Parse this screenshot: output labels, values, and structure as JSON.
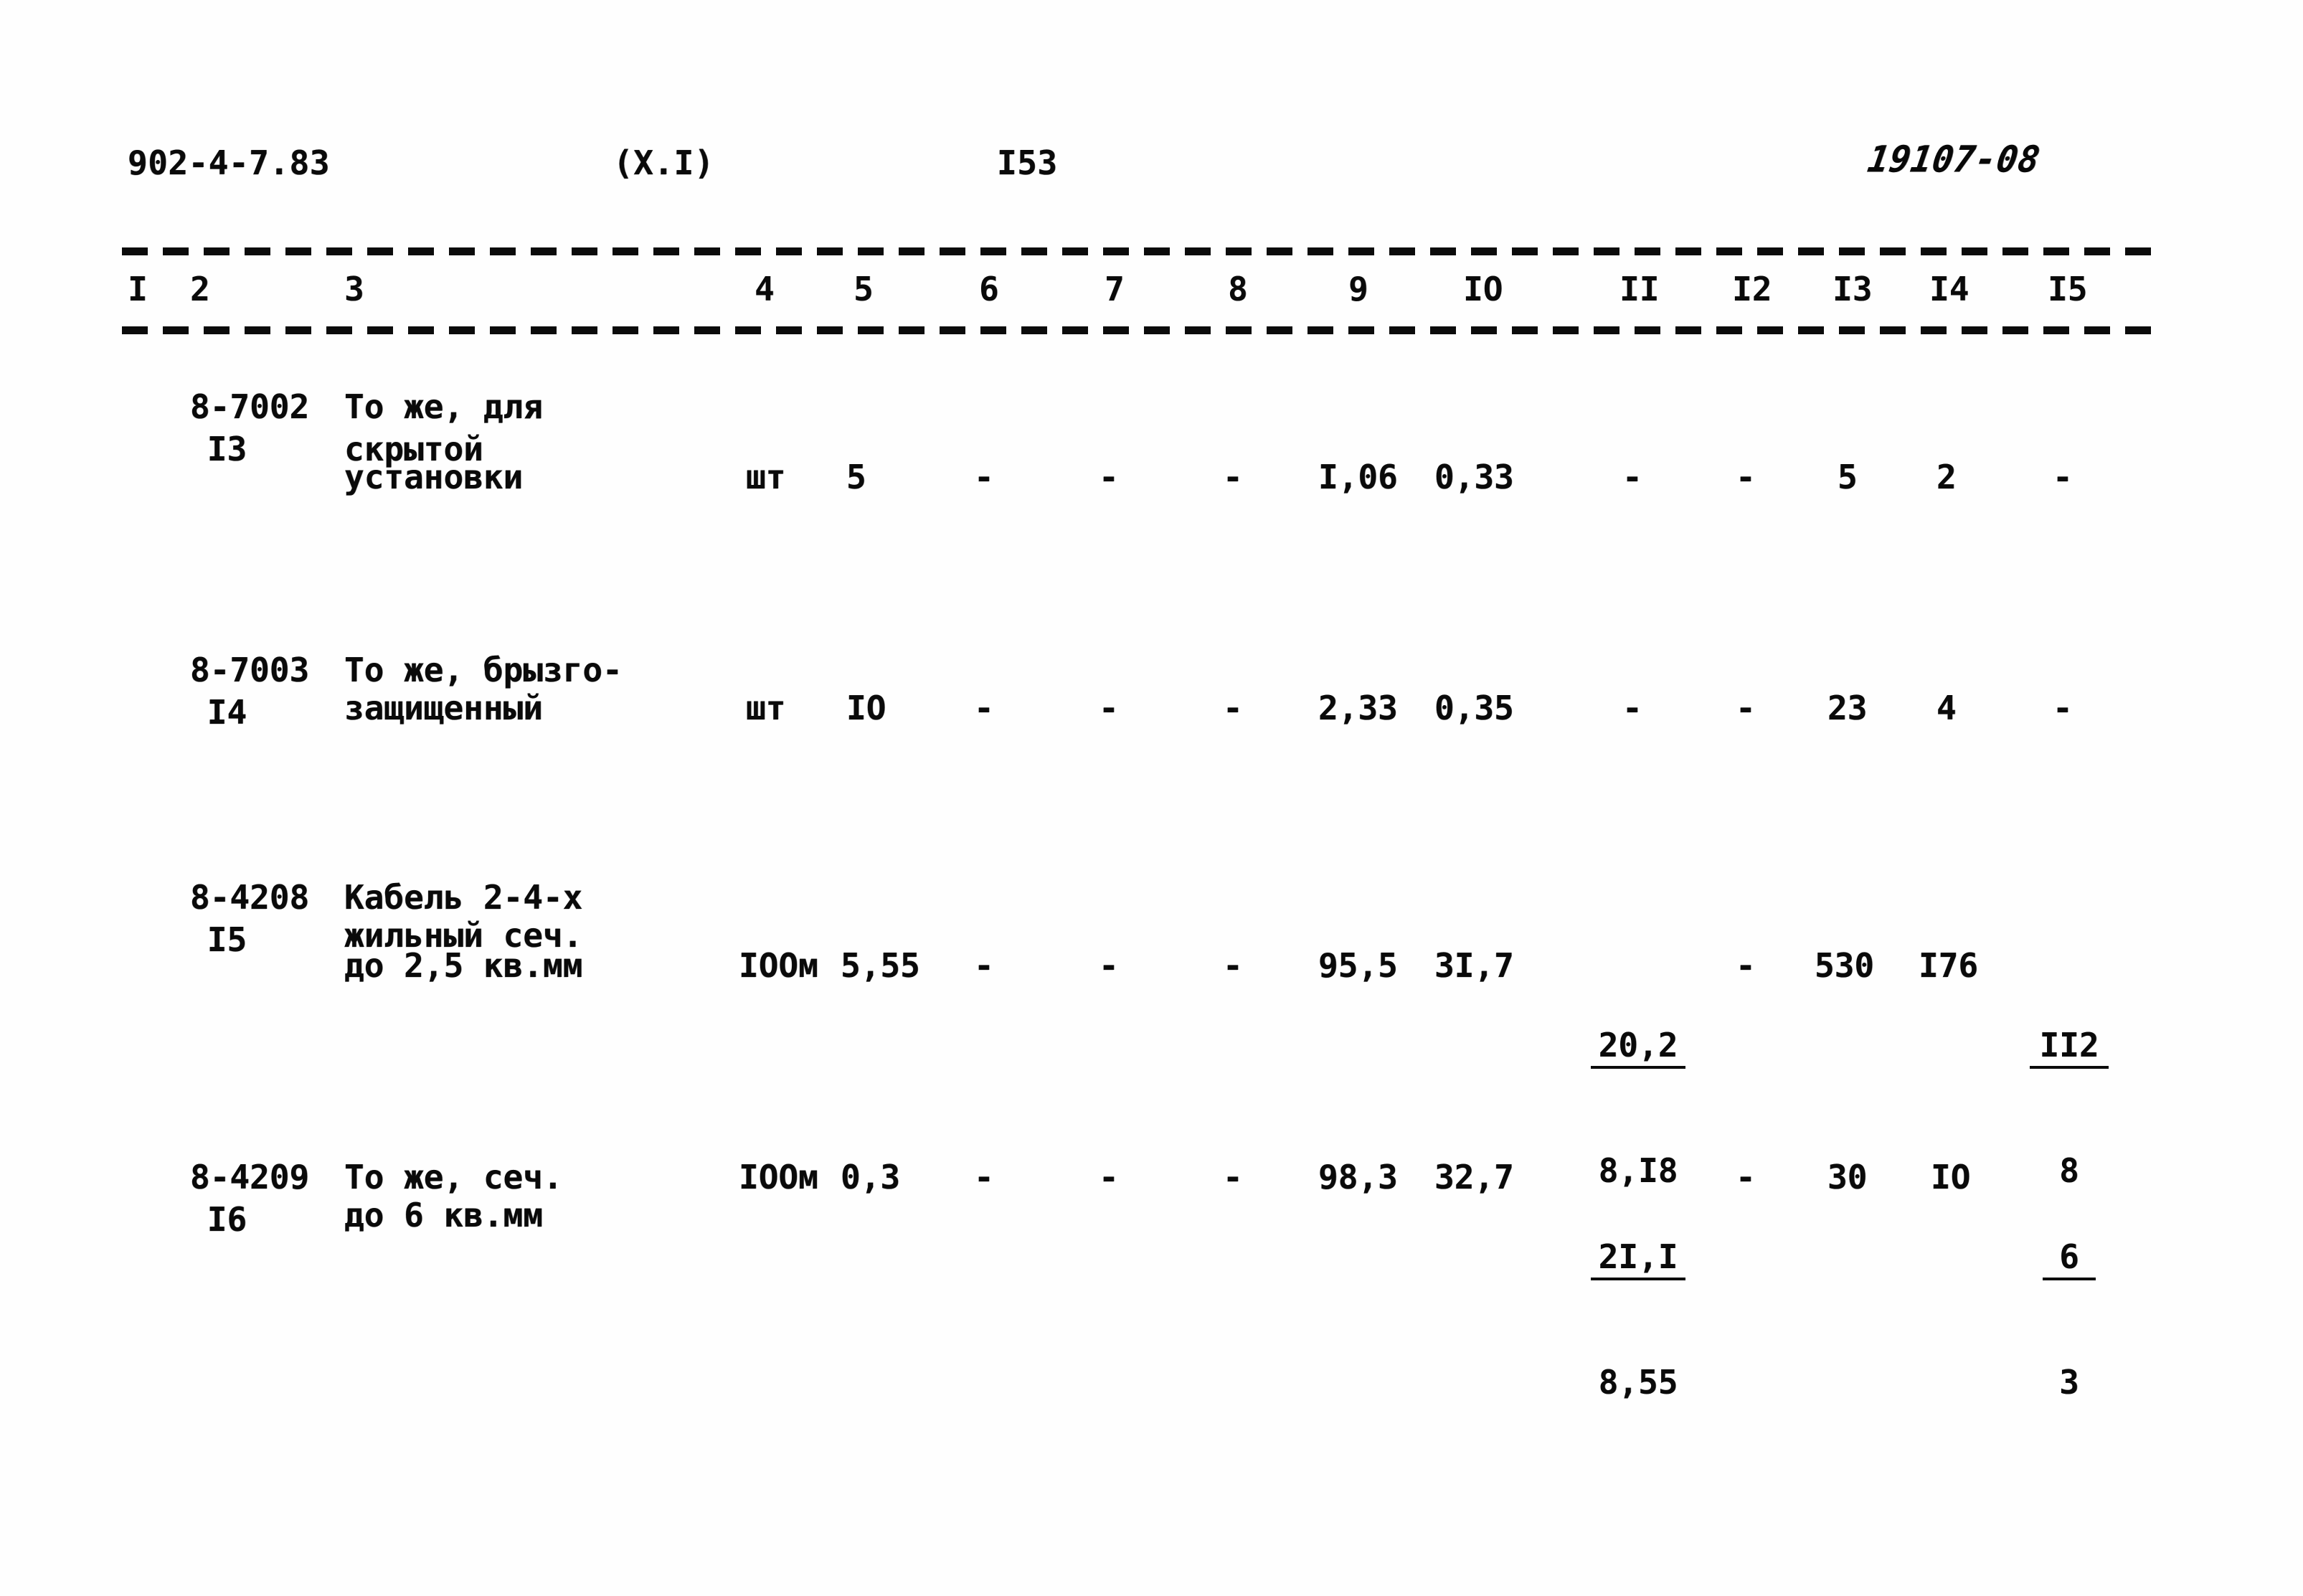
{
  "document": {
    "series_code": "902-4-7.83",
    "section": "(X.I)",
    "page_number": "I53",
    "archive_stamp": "19107-08"
  },
  "table": {
    "column_headers": [
      "I",
      "2",
      "3",
      "4",
      "5",
      "6",
      "7",
      "8",
      "9",
      "IO",
      "II",
      "I2",
      "I3",
      "I4",
      "I5"
    ],
    "rows": [
      {
        "no": "I3",
        "code": "8-7002",
        "description_lines": [
          "То же, для",
          "скрытой",
          "установки"
        ],
        "unit": "шт",
        "c5": "5",
        "c6": "-",
        "c7": "-",
        "c8": "-",
        "c9": "I,06",
        "c10": "0,33",
        "c11": "-",
        "c11_num": "",
        "c11_den": "",
        "c12": "-",
        "c13": "5",
        "c14": "2",
        "c15": "-",
        "c15_num": "",
        "c15_den": ""
      },
      {
        "no": "I4",
        "code": "8-7003",
        "description_lines": [
          "То же, брызго-",
          "защищенный"
        ],
        "unit": "шт",
        "c5": "IO",
        "c6": "-",
        "c7": "-",
        "c8": "-",
        "c9": "2,33",
        "c10": "0,35",
        "c11": "-",
        "c11_num": "",
        "c11_den": "",
        "c12": "-",
        "c13": "23",
        "c14": "4",
        "c15": "-",
        "c15_num": "",
        "c15_den": ""
      },
      {
        "no": "I5",
        "code": "8-4208",
        "description_lines": [
          "Кабель 2-4-х",
          "жильный сеч.",
          "до 2,5 кв.мм"
        ],
        "unit": "IOOм",
        "c5": "5,55",
        "c6": "-",
        "c7": "-",
        "c8": "-",
        "c9": "95,5",
        "c10": "3I,7",
        "c11": "",
        "c11_num": "20,2",
        "c11_den": "8,I8",
        "c12": "-",
        "c13": "530",
        "c14": "I76",
        "c15": "",
        "c15_num": "II2",
        "c15_den": "8"
      },
      {
        "no": "I6",
        "code": "8-4209",
        "description_lines": [
          "То же, сеч.",
          "до 6 кв.мм"
        ],
        "unit": "IOOм",
        "c5": "0,3",
        "c6": "-",
        "c7": "-",
        "c8": "-",
        "c9": "98,3",
        "c10": "32,7",
        "c11": "",
        "c11_num": "2I,I",
        "c11_den": "8,55",
        "c12": "-",
        "c13": "30",
        "c14": "IO",
        "c15": "",
        "c15_num": "6",
        "c15_den": "3"
      }
    ]
  },
  "colors": {
    "ink": "#0a0a0a",
    "paper": "#fefefe"
  }
}
